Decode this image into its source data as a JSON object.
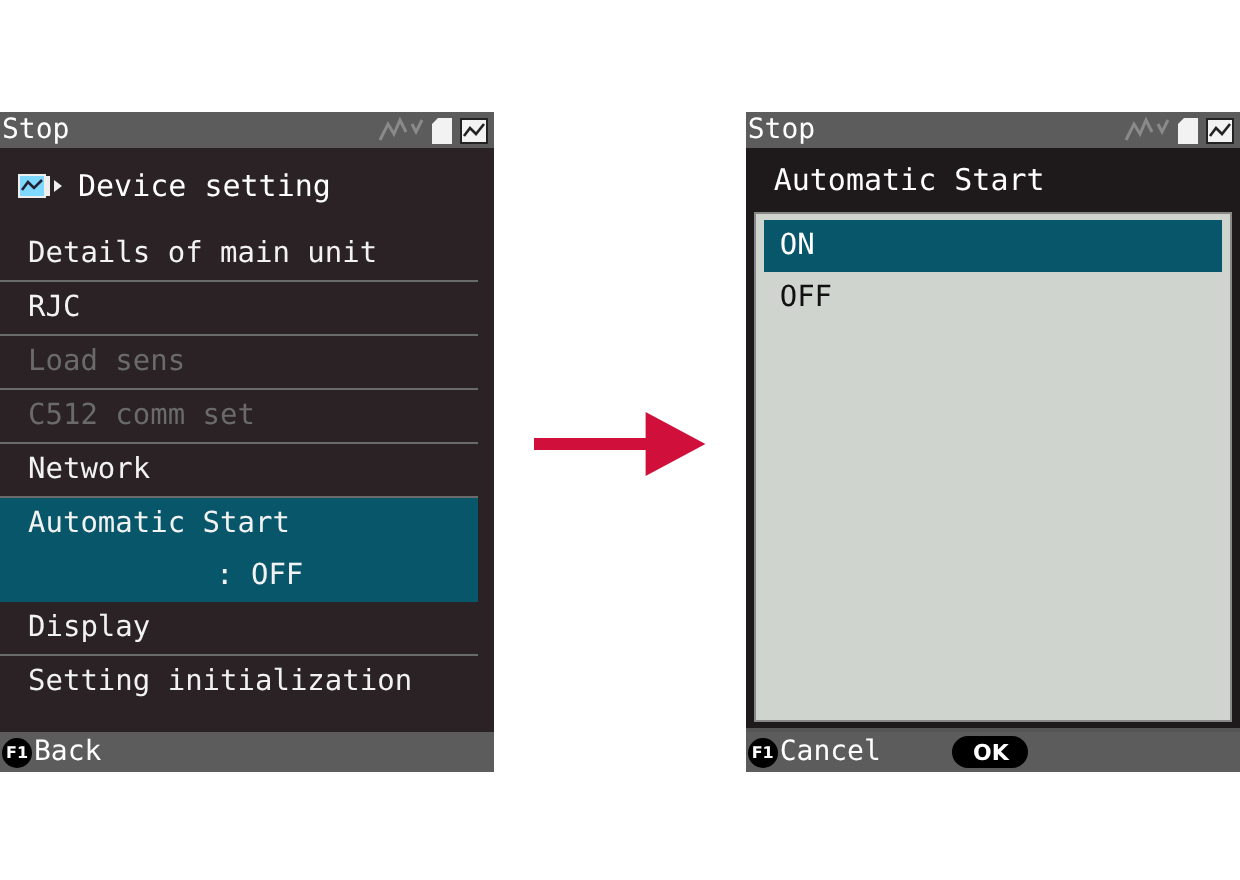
{
  "screens": [
    {
      "kind": "menu",
      "status": {
        "text": "Stop"
      },
      "title": "Device setting",
      "items": [
        {
          "label": "Details of main unit",
          "disabled": false,
          "selected": false
        },
        {
          "label": "RJC",
          "disabled": false,
          "selected": false
        },
        {
          "label": "Load sens",
          "disabled": true,
          "selected": false
        },
        {
          "label": "C512 comm set",
          "disabled": true,
          "selected": false
        },
        {
          "label": "Network",
          "disabled": false,
          "selected": false
        },
        {
          "label": "Automatic Start",
          "value": ": OFF",
          "disabled": false,
          "selected": true
        },
        {
          "label": "Display",
          "disabled": false,
          "selected": false
        },
        {
          "label": "Setting initialization",
          "disabled": false,
          "selected": false
        }
      ],
      "footer": {
        "key": "F1",
        "label": "Back"
      }
    },
    {
      "kind": "dialog",
      "status": {
        "text": "Stop"
      },
      "title": "Automatic Start",
      "options": [
        {
          "label": "ON",
          "selected": true
        },
        {
          "label": "OFF",
          "selected": false
        }
      ],
      "footer": {
        "key": "F1",
        "label": "Cancel",
        "ok": "OK"
      }
    }
  ]
}
